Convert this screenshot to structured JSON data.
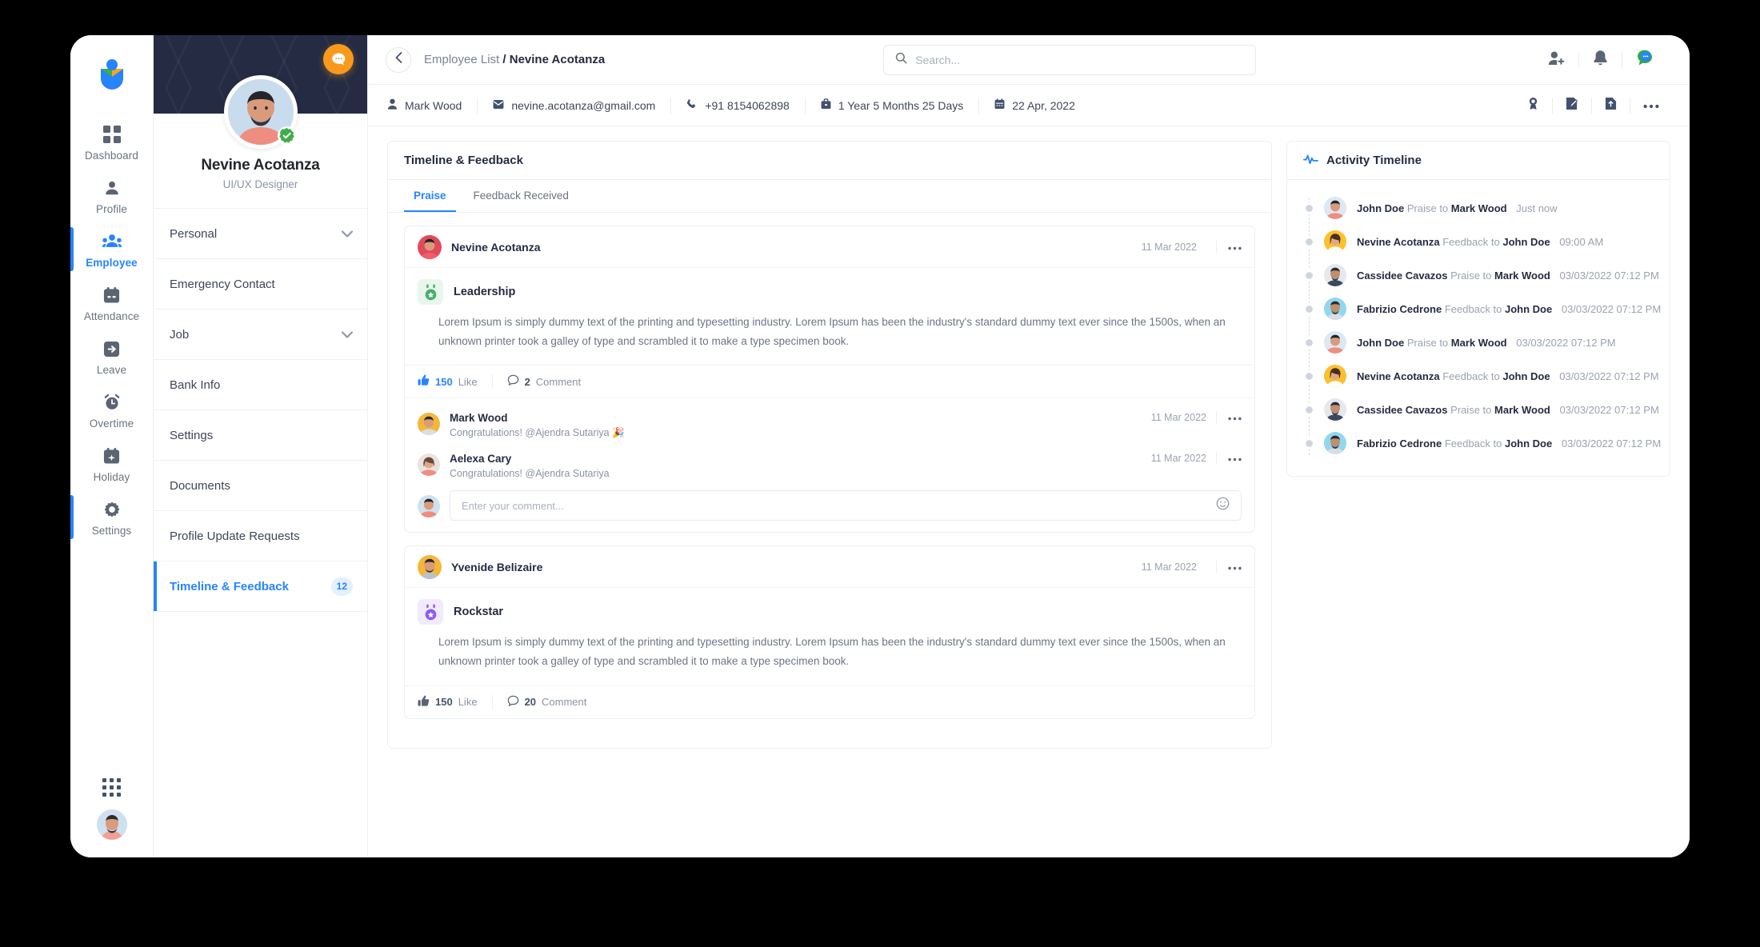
{
  "brand": {
    "logo_name": "company-logo"
  },
  "rail": {
    "items": [
      {
        "label": "Dashboard",
        "icon": "grid-icon",
        "active": false
      },
      {
        "label": "Profile",
        "icon": "user-icon",
        "active": false
      },
      {
        "label": "Employee",
        "icon": "people-icon",
        "active": true
      },
      {
        "label": "Attendance",
        "icon": "calendar-check-icon",
        "active": false
      },
      {
        "label": "Leave",
        "icon": "exit-arrow-icon",
        "active": false
      },
      {
        "label": "Overtime",
        "icon": "alarm-clock-icon",
        "active": false
      },
      {
        "label": "Holiday",
        "icon": "calendar-plane-icon",
        "active": false
      },
      {
        "label": "Settings",
        "icon": "gear-icon",
        "active": false
      }
    ]
  },
  "topbar": {
    "back_icon": "chevron-left-icon",
    "breadcrumb_parent": "Employee List",
    "breadcrumb_sep": "/",
    "breadcrumb_current": "Nevine Acotanza",
    "search_placeholder": "Search...",
    "search_value": "",
    "actions": [
      "add-user-icon",
      "bell-icon",
      "chat-bubble-icon"
    ]
  },
  "profile": {
    "name": "Nevine Acotanza",
    "role": "UI/UX Designer",
    "chat_icon": "chat-bubble-icon",
    "verified_icon": "verified-badge-icon",
    "menu": [
      {
        "label": "Personal",
        "chevron": true,
        "badge": "",
        "active": false
      },
      {
        "label": "Emergency Contact",
        "chevron": false,
        "badge": "",
        "active": false
      },
      {
        "label": "Job",
        "chevron": true,
        "badge": "",
        "active": false
      },
      {
        "label": "Bank Info",
        "chevron": false,
        "badge": "",
        "active": false
      },
      {
        "label": "Settings",
        "chevron": false,
        "badge": "",
        "active": false
      },
      {
        "label": "Documents",
        "chevron": false,
        "badge": "",
        "active": false
      },
      {
        "label": "Profile Update Requests",
        "chevron": false,
        "badge": "",
        "active": false
      },
      {
        "label": "Timeline & Feedback",
        "chevron": false,
        "badge": "12",
        "active": true
      }
    ]
  },
  "infobar": {
    "chips": [
      {
        "icon": "user-icon",
        "text": "Mark Wood"
      },
      {
        "icon": "mail-icon",
        "text": "nevine.acotanza@gmail.com"
      },
      {
        "icon": "phone-icon",
        "text": "+91 8154062898"
      },
      {
        "icon": "briefcase-icon",
        "text": "1 Year 5 Months 25 Days"
      },
      {
        "icon": "calendar-icon",
        "text": "22 Apr, 2022"
      }
    ],
    "actions": [
      "award-icon",
      "edit-note-icon",
      "file-upload-icon",
      "more-horizontal-icon"
    ]
  },
  "feed": {
    "title": "Timeline & Feedback",
    "tabs": [
      {
        "label": "Praise",
        "active": true
      },
      {
        "label": "Feedback Received",
        "active": false
      }
    ],
    "posts": [
      {
        "author": "Nevine Acotanza",
        "date": "11 Mar 2022",
        "award": "Leadership",
        "award_color": "green",
        "text": "Lorem Ipsum is simply dummy text of the printing and typesetting industry. Lorem Ipsum has been the industry's standard dummy text ever since the 1500s, when an unknown printer took a galley of type and scrambled it to make a type specimen book.",
        "likes": "150",
        "like_label": "Like",
        "comments_count": "2",
        "comment_label": "Comment",
        "comments": [
          {
            "name": "Mark Wood",
            "date": "11 Mar 2022",
            "text": "Congratulations! @Ajendra Sutariya 🎉"
          },
          {
            "name": "Aelexa Cary",
            "date": "11 Mar 2022",
            "text": "Congratulations! @Ajendra Sutariya"
          }
        ],
        "comment_placeholder": "Enter your comment...",
        "comment_value": ""
      },
      {
        "author": "Yvenide Belizaire",
        "date": "11 Mar 2022",
        "award": "Rockstar",
        "award_color": "purple",
        "text": "Lorem Ipsum is simply dummy text of the printing and typesetting industry. Lorem Ipsum has been the industry's standard dummy text ever since the 1500s, when an unknown printer took a galley of type and scrambled it to make a type specimen book.",
        "likes": "150",
        "like_label": "Like",
        "comments_count": "20",
        "comment_label": "Comment",
        "comments": [],
        "comment_placeholder": "",
        "comment_value": ""
      }
    ]
  },
  "activity": {
    "title": "Activity Timeline",
    "icon": "pulse-icon",
    "items": [
      {
        "actor": "John Doe",
        "verb": "Praise to",
        "target": "Mark Wood",
        "time": "Just now",
        "avatar": "pink"
      },
      {
        "actor": "Nevine Acotanza",
        "verb": "Feedback to",
        "target": "John Doe",
        "time": "09:00 AM",
        "avatar": "yellow"
      },
      {
        "actor": "Cassidee Cavazos",
        "verb": "Praise to",
        "target": "Mark Wood",
        "time": "03/03/2022 07:12 PM",
        "avatar": "grey"
      },
      {
        "actor": "Fabrizio Cedrone",
        "verb": "Feedback to",
        "target": "John Doe",
        "time": "03/03/2022 07:12 PM",
        "avatar": "blue"
      },
      {
        "actor": "John Doe",
        "verb": "Praise to",
        "target": "Mark Wood",
        "time": "03/03/2022 07:12 PM",
        "avatar": "pink"
      },
      {
        "actor": "Nevine Acotanza",
        "verb": "Feedback to",
        "target": "John Doe",
        "time": "03/03/2022 07:12 PM",
        "avatar": "yellow"
      },
      {
        "actor": "Cassidee Cavazos",
        "verb": "Praise to",
        "target": "Mark Wood",
        "time": "03/03/2022 07:12 PM",
        "avatar": "grey"
      },
      {
        "actor": "Fabrizio Cedrone",
        "verb": "Feedback to",
        "target": "John Doe",
        "time": "03/03/2022 07:12 PM",
        "avatar": "blue"
      }
    ]
  },
  "colors": {
    "accent": "#2684ff",
    "cover": "#242b42",
    "orange": "#f99a1c",
    "green": "#45b06a",
    "purple": "#8b5cf6",
    "text_dark": "#242b42",
    "text_muted": "#8b93a3"
  }
}
